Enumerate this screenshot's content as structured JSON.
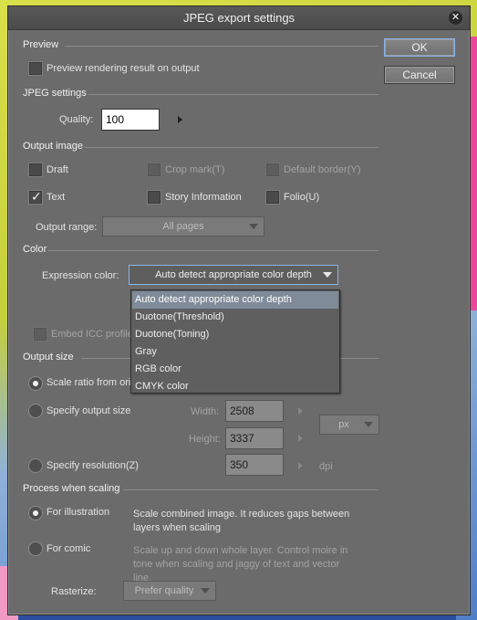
{
  "window": {
    "title": "JPEG export settings"
  },
  "buttons": {
    "ok": "OK",
    "cancel": "Cancel"
  },
  "preview": {
    "title": "Preview",
    "rendering_checkbox": {
      "label": "Preview rendering result on output",
      "checked": false
    }
  },
  "jpeg": {
    "title": "JPEG settings",
    "quality_label": "Quality:",
    "quality_value": "100"
  },
  "output_image": {
    "title": "Output image",
    "draft": "Draft",
    "crop_mark": "Crop mark(T)",
    "default_border": "Default border(Y)",
    "text": "Text",
    "text_checked": true,
    "story_information": "Story Information",
    "folio": "Folio(U)",
    "output_range_label": "Output range:",
    "output_range_value": "All pages"
  },
  "color": {
    "title": "Color",
    "expression_label": "Expression color:",
    "expression_value": "Auto detect appropriate color depth",
    "options": [
      "Auto detect appropriate color depth",
      "Duotone(Threshold)",
      "Duotone(Toning)",
      "Gray",
      "RGB color",
      "CMYK color"
    ],
    "embed_icc": "Embed ICC profile"
  },
  "output_size": {
    "title": "Output size",
    "scale_ratio": "Scale ratio from orig",
    "specify_size": "Specify output size",
    "width_label": "Width:",
    "width_value": "2508",
    "height_label": "Height:",
    "height_value": "3337",
    "unit": "px",
    "specify_resolution": "Specify resolution(Z)",
    "resolution_value": "350",
    "dpi": "dpi"
  },
  "scaling": {
    "title": "Process when scaling",
    "illustration": "For illustration",
    "illustration_desc": "Scale combined image. It reduces gaps between layers when scaling",
    "comic": "For comic",
    "comic_desc": "Scale up and down whole layer. Control moire in tone when scaling and jaggy of text and vector line.",
    "rasterize_label": "Rasterize:",
    "rasterize_value": "Prefer quality"
  },
  "colors": {
    "accent_border": "#8ab4e8",
    "dialog_bg": "#6b6b6b",
    "dropdown_highlight": "#7f8b98"
  },
  "icons": {
    "close": "close-icon",
    "check": "checkmark-icon"
  }
}
